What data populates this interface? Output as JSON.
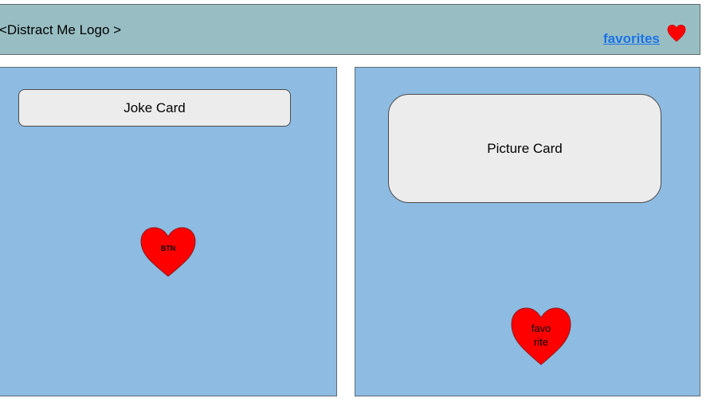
{
  "header": {
    "logo_text": "<Distract Me Logo >",
    "favorites_link": "favorites"
  },
  "joke_panel": {
    "card_label": "Joke Card",
    "button_label": "BTN"
  },
  "picture_panel": {
    "card_label": "Picture Card",
    "favorite_label_line1": "favo",
    "favorite_label_line2": "rite"
  },
  "colors": {
    "header_bg": "#98bec3",
    "panel_bg": "#8dbbe2",
    "card_bg": "#ececec",
    "heart": "#ff0000",
    "link": "#1a73e8"
  },
  "icons": {
    "favorites": "heart-icon",
    "joke_button": "heart-icon",
    "favorite_button": "heart-icon"
  }
}
